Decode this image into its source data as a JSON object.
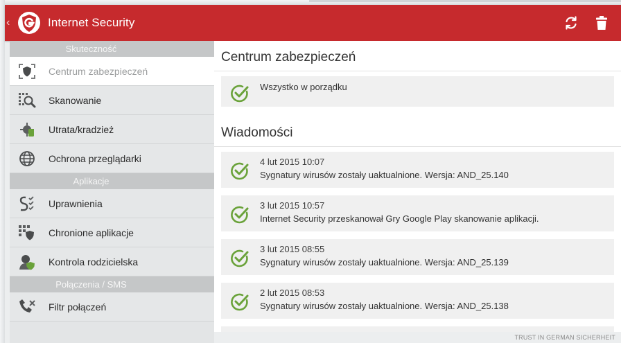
{
  "app": {
    "title": "Internet Security"
  },
  "colors": {
    "appbar": "#c62a2d",
    "accent_green": "#6aa23a",
    "active_item": "#ffffff"
  },
  "icons": {
    "back": "chevron-left-icon",
    "logo": "g-data-shield-logo",
    "refresh": "refresh-icon",
    "delete": "trash-icon"
  },
  "sidebar": {
    "sections": [
      {
        "header": "Skuteczność",
        "items": [
          {
            "label": "Centrum zabezpieczeń",
            "icon": "security-center-icon",
            "active": true
          },
          {
            "label": "Skanowanie",
            "icon": "scan-icon"
          },
          {
            "label": "Utrata/kradzież",
            "icon": "anti-theft-icon"
          },
          {
            "label": "Ochrona przeglądarki",
            "icon": "browser-globe-icon"
          }
        ]
      },
      {
        "header": "Aplikacje",
        "items": [
          {
            "label": "Uprawnienia",
            "icon": "permissions-icon"
          },
          {
            "label": "Chronione aplikacje",
            "icon": "protected-apps-icon"
          },
          {
            "label": "Kontrola rodzicielska",
            "icon": "parental-control-icon"
          }
        ]
      },
      {
        "header": "Połączenia / SMS",
        "items": [
          {
            "label": "Filtr połączeń",
            "icon": "call-filter-icon"
          }
        ]
      }
    ]
  },
  "main": {
    "status_title": "Centrum zabezpieczeń",
    "status_text": "Wszystko w porządku",
    "messages_title": "Wiadomości",
    "messages": [
      {
        "time": "4 lut 2015 10:07",
        "text": "Sygnatury wirusów zostały uaktualnione. Wersja: AND_25.140"
      },
      {
        "time": "3 lut 2015 10:57",
        "text": "Internet Security przeskanował Gry Google Play skanowanie aplikacji."
      },
      {
        "time": "3 lut 2015 08:55",
        "text": "Sygnatury wirusów zostały uaktualnione. Wersja: AND_25.139"
      },
      {
        "time": "2 lut 2015 08:53",
        "text": "Sygnatury wirusów zostały uaktualnione. Wersja: AND_25.138"
      }
    ]
  },
  "footer": {
    "tagline": "TRUST IN GERMAN SICHERHEIT"
  }
}
